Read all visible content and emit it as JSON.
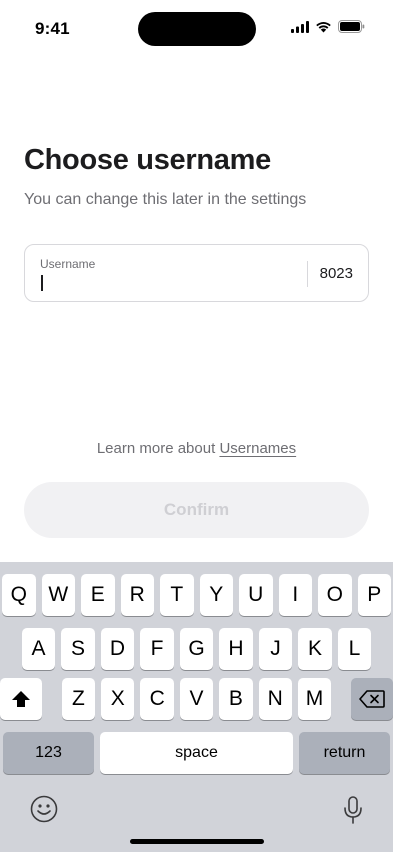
{
  "status_bar": {
    "time": "9:41"
  },
  "header": {
    "title": "Choose username",
    "subtitle": "You can change this later in the settings"
  },
  "username_field": {
    "label": "Username",
    "value": "",
    "suffix": "8023"
  },
  "learn_more": {
    "prefix": "Learn more about",
    "link": "Usernames"
  },
  "confirm_button": {
    "label": "Confirm",
    "enabled": false
  },
  "keyboard": {
    "row1": [
      "Q",
      "W",
      "E",
      "R",
      "T",
      "Y",
      "U",
      "I",
      "O",
      "P"
    ],
    "row2": [
      "A",
      "S",
      "D",
      "F",
      "G",
      "H",
      "J",
      "K",
      "L"
    ],
    "row3": [
      "Z",
      "X",
      "C",
      "V",
      "B",
      "N",
      "M"
    ],
    "numbers_label": "123",
    "space_label": "space",
    "return_label": "return"
  },
  "colors": {
    "text_primary": "#1c1c1e",
    "text_secondary": "#6e6e73",
    "keyboard_bg": "#d1d3d9",
    "button_disabled_bg": "#f1f1f3"
  }
}
